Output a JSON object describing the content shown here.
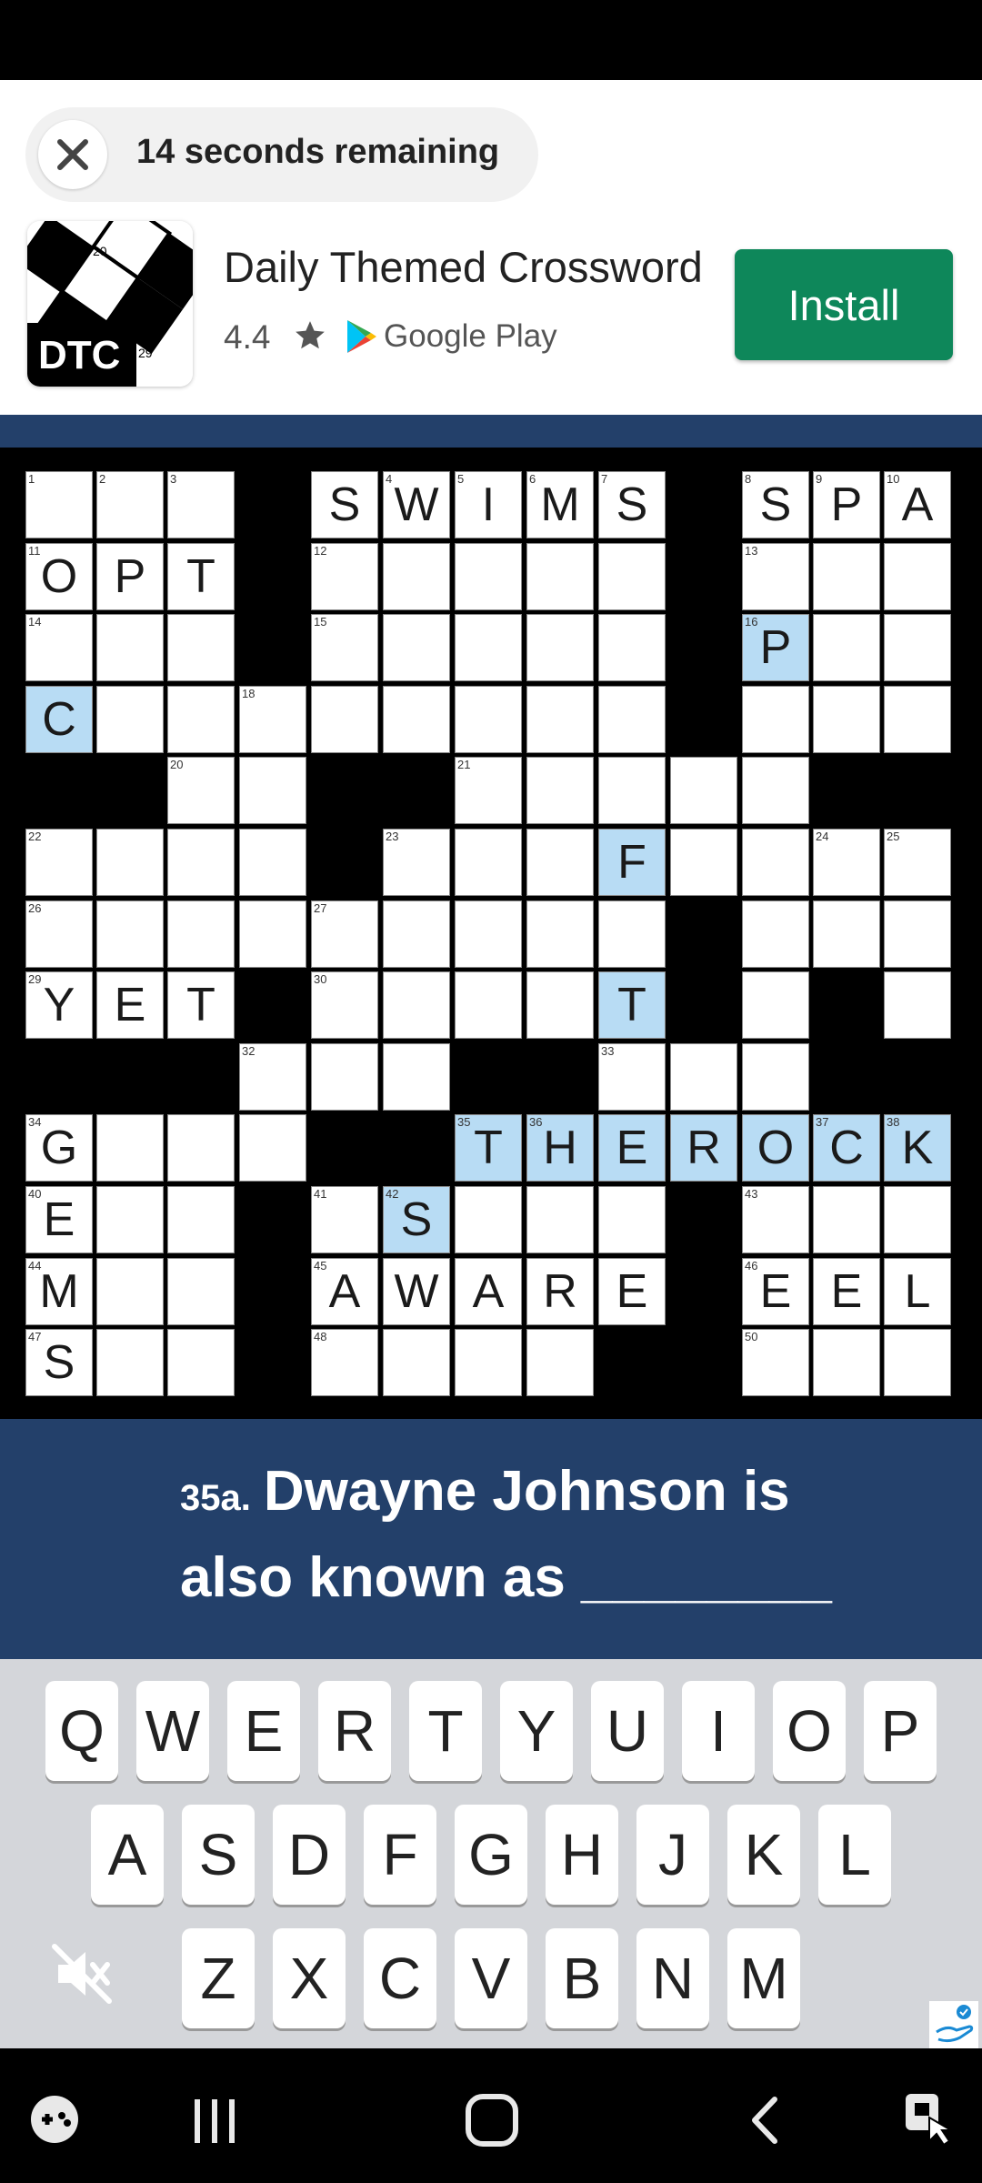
{
  "ad": {
    "timer_text": "14 seconds remaining",
    "app_icon_label": "DTC",
    "app_icon_num1": "20",
    "app_icon_num2": "29",
    "app_name": "Daily Themed Crossword",
    "rating": "4.4",
    "store": "Google Play",
    "install_label": "Install",
    "install_color": "#0e875a"
  },
  "clue": {
    "number": "35a.",
    "text": "Dwayne Johnson is also known as ________"
  },
  "grid": {
    "highlight_color": "#b8dcf4",
    "rows": [
      {
        "cells": [
          {
            "c": 0,
            "n": "1"
          },
          {
            "c": 1,
            "n": "2"
          },
          {
            "c": 2,
            "n": "3"
          },
          {
            "c": 4,
            "n": "",
            "l": "S"
          },
          {
            "c": 5,
            "n": "4",
            "l": "W"
          },
          {
            "c": 6,
            "n": "5",
            "l": "I"
          },
          {
            "c": 7,
            "n": "6",
            "l": "M"
          },
          {
            "c": 8,
            "n": "7",
            "l": "S"
          },
          {
            "c": 10,
            "n": "8",
            "l": "S"
          },
          {
            "c": 11,
            "n": "9",
            "l": "P"
          },
          {
            "c": 12,
            "n": "10",
            "l": "A"
          }
        ]
      },
      {
        "cells": [
          {
            "c": 0,
            "n": "11",
            "l": "O"
          },
          {
            "c": 1,
            "l": "P"
          },
          {
            "c": 2,
            "l": "T"
          },
          {
            "c": 4,
            "n": "12"
          },
          {
            "c": 5
          },
          {
            "c": 6
          },
          {
            "c": 7
          },
          {
            "c": 8
          },
          {
            "c": 10,
            "n": "13"
          },
          {
            "c": 11
          },
          {
            "c": 12
          }
        ]
      },
      {
        "cells": [
          {
            "c": 0,
            "n": "14"
          },
          {
            "c": 1
          },
          {
            "c": 2
          },
          {
            "c": 4,
            "n": "15"
          },
          {
            "c": 5
          },
          {
            "c": 6
          },
          {
            "c": 7
          },
          {
            "c": 8
          },
          {
            "c": 10,
            "n": "16",
            "l": "P",
            "h": true
          },
          {
            "c": 11
          },
          {
            "c": 12
          }
        ]
      },
      {
        "cells": [
          {
            "c": 0,
            "l": "C",
            "h": true
          },
          {
            "c": 1
          },
          {
            "c": 2
          },
          {
            "c": 3,
            "n": "18"
          },
          {
            "c": 4
          },
          {
            "c": 5
          },
          {
            "c": 6
          },
          {
            "c": 7
          },
          {
            "c": 8
          },
          {
            "c": 10
          },
          {
            "c": 11
          },
          {
            "c": 12
          }
        ]
      },
      {
        "cells": [
          {
            "c": 2,
            "n": "20"
          },
          {
            "c": 3
          },
          {
            "c": 6,
            "n": "21"
          },
          {
            "c": 7
          },
          {
            "c": 8
          },
          {
            "c": 9
          },
          {
            "c": 10
          }
        ]
      },
      {
        "cells": [
          {
            "c": 0,
            "n": "22"
          },
          {
            "c": 1
          },
          {
            "c": 2
          },
          {
            "c": 3
          },
          {
            "c": 5,
            "n": "23"
          },
          {
            "c": 6
          },
          {
            "c": 7
          },
          {
            "c": 8,
            "l": "F",
            "h": true
          },
          {
            "c": 9
          },
          {
            "c": 10
          },
          {
            "c": 11,
            "n": "24"
          },
          {
            "c": 12,
            "n": "25"
          }
        ]
      },
      {
        "cells": [
          {
            "c": 0,
            "n": "26"
          },
          {
            "c": 1
          },
          {
            "c": 2
          },
          {
            "c": 3
          },
          {
            "c": 4,
            "n": "27"
          },
          {
            "c": 5
          },
          {
            "c": 6
          },
          {
            "c": 7
          },
          {
            "c": 8
          },
          {
            "c": 10
          },
          {
            "c": 11
          },
          {
            "c": 12
          }
        ]
      },
      {
        "cells": [
          {
            "c": 0,
            "n": "29",
            "l": "Y"
          },
          {
            "c": 1,
            "l": "E"
          },
          {
            "c": 2,
            "l": "T"
          },
          {
            "c": 4,
            "n": "30"
          },
          {
            "c": 5
          },
          {
            "c": 6
          },
          {
            "c": 7
          },
          {
            "c": 8,
            "l": "T",
            "h": true
          },
          {
            "c": 10
          },
          {
            "c": 12
          }
        ]
      },
      {
        "cells": [
          {
            "c": 3,
            "n": "32"
          },
          {
            "c": 4
          },
          {
            "c": 5
          },
          {
            "c": 8,
            "n": "33"
          },
          {
            "c": 9
          },
          {
            "c": 10
          }
        ]
      },
      {
        "cells": [
          {
            "c": 0,
            "n": "34",
            "l": "G"
          },
          {
            "c": 1
          },
          {
            "c": 2
          },
          {
            "c": 3
          },
          {
            "c": 6,
            "n": "35",
            "l": "T",
            "h": true
          },
          {
            "c": 7,
            "n": "36",
            "l": "H",
            "h": true
          },
          {
            "c": 8,
            "l": "E",
            "h": true
          },
          {
            "c": 9,
            "l": "R",
            "h": true
          },
          {
            "c": 10,
            "l": "O",
            "h": true
          },
          {
            "c": 11,
            "n": "37",
            "l": "C",
            "h": true
          },
          {
            "c": 12,
            "n": "38",
            "l": "K",
            "h": true
          }
        ]
      },
      {
        "cells": [
          {
            "c": 0,
            "n": "40",
            "l": "E"
          },
          {
            "c": 1
          },
          {
            "c": 2
          },
          {
            "c": 4,
            "n": "41"
          },
          {
            "c": 5,
            "n": "42",
            "l": "S",
            "h": true
          },
          {
            "c": 6
          },
          {
            "c": 7
          },
          {
            "c": 8
          },
          {
            "c": 10,
            "n": "43"
          },
          {
            "c": 11
          },
          {
            "c": 12
          }
        ]
      },
      {
        "cells": [
          {
            "c": 0,
            "n": "44",
            "l": "M"
          },
          {
            "c": 1
          },
          {
            "c": 2
          },
          {
            "c": 4,
            "n": "45",
            "l": "A"
          },
          {
            "c": 5,
            "l": "W"
          },
          {
            "c": 6,
            "l": "A"
          },
          {
            "c": 7,
            "l": "R"
          },
          {
            "c": 8,
            "l": "E"
          },
          {
            "c": 10,
            "n": "46",
            "l": "E"
          },
          {
            "c": 11,
            "l": "E"
          },
          {
            "c": 12,
            "l": "L"
          }
        ]
      },
      {
        "cells": [
          {
            "c": 0,
            "n": "47",
            "l": "S"
          },
          {
            "c": 1
          },
          {
            "c": 2
          },
          {
            "c": 4,
            "n": "48"
          },
          {
            "c": 5
          },
          {
            "c": 6
          },
          {
            "c": 7
          },
          {
            "c": 10,
            "n": "50"
          },
          {
            "c": 11
          },
          {
            "c": 12
          }
        ]
      }
    ]
  },
  "keyboard": {
    "rows": [
      [
        "Q",
        "W",
        "E",
        "R",
        "T",
        "Y",
        "U",
        "I",
        "O",
        "P"
      ],
      [
        "A",
        "S",
        "D",
        "F",
        "G",
        "H",
        "J",
        "K",
        "L"
      ],
      [
        "Z",
        "X",
        "C",
        "V",
        "B",
        "N",
        "M"
      ]
    ]
  },
  "icons": {
    "close": "close-icon",
    "star": "star-icon",
    "store": "google-play-icon",
    "mute": "mute-icon",
    "ad_badge": "ad-choices-icon",
    "nav_game": "gamepad-icon",
    "nav_recents": "recents-icon",
    "nav_home": "home-icon",
    "nav_back": "back-icon",
    "nav_screenshot": "screenshot-icon"
  }
}
